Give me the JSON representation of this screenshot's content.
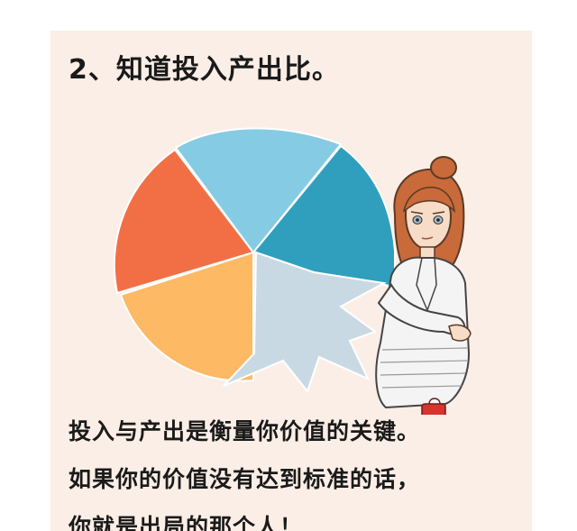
{
  "article": {
    "heading": "2、知道投入产出比。",
    "lines": [
      "投入与产出是衡量你价值的关键。",
      "如果你的价值没有达到标准的话，",
      "你就是出局的那个人！"
    ]
  },
  "illustration": {
    "icons": [
      "pie-chart-icon",
      "businesswoman-icon"
    ],
    "colors": {
      "orange_red": "#f26f45",
      "light_blue": "#85cbe4",
      "teal": "#2f9fbd",
      "yellow_orange": "#fdb963",
      "grey_blue": "#c9d9e4",
      "hair": "#c86a3a",
      "coat": "#f4f4f4"
    }
  }
}
